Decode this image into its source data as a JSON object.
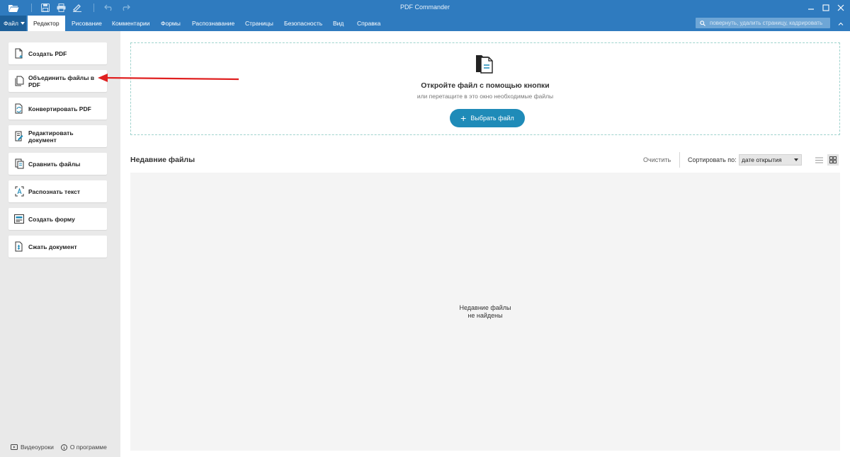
{
  "app": {
    "title": "PDF Commander"
  },
  "menubar": {
    "file_label": "Файл",
    "items": [
      "Редактор",
      "Рисование",
      "Комментарии",
      "Формы",
      "Распознавание",
      "Страницы",
      "Безопасность",
      "Вид",
      "Справка"
    ],
    "active_index": 0,
    "search_placeholder": "повернуть, удалить страницу, кадрировать"
  },
  "sidebar": {
    "buttons": [
      {
        "label": "Создать PDF",
        "icon": "new-pdf-icon"
      },
      {
        "label": "Объединить файлы в PDF",
        "icon": "merge-files-icon"
      },
      {
        "label": "Конвертировать PDF",
        "icon": "convert-pdf-icon"
      },
      {
        "label": "Редактировать документ",
        "icon": "edit-document-icon"
      },
      {
        "label": "Сравнить файлы",
        "icon": "compare-files-icon"
      },
      {
        "label": "Распознать текст",
        "icon": "ocr-icon"
      },
      {
        "label": "Создать форму",
        "icon": "form-icon"
      },
      {
        "label": "Сжать документ",
        "icon": "compress-icon"
      }
    ],
    "footer": {
      "tutorials": "Видеоуроки",
      "about": "О программе"
    }
  },
  "dropzone": {
    "title": "Откройте файл с помощью кнопки",
    "subtitle": "или перетащите в это окно необходимые файлы",
    "button_label": "Выбрать файл"
  },
  "recent": {
    "title": "Недавние файлы",
    "clear_label": "Очистить",
    "sort_label": "Сортировать по:",
    "sort_value": "дате открытия",
    "empty_line1": "Недавние файлы",
    "empty_line2": "не найдены",
    "view_mode": "grid"
  },
  "colors": {
    "accent": "#2f7bbf",
    "button": "#1f8bb8",
    "annotation_arrow": "#e02020"
  }
}
